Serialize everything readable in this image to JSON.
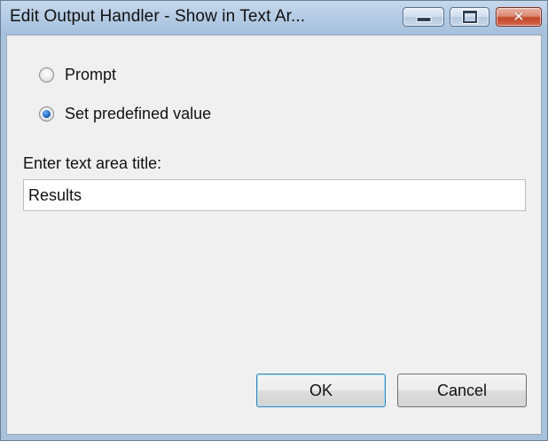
{
  "window": {
    "title": "Edit Output Handler - Show in Text Ar...",
    "minimize_icon": "minimize-icon",
    "maximize_icon": "maximize-icon",
    "close_icon": "close-icon",
    "close_glyph": "✕"
  },
  "options": {
    "prompt_label": "Prompt",
    "predefined_label": "Set predefined value",
    "selected": "predefined"
  },
  "field": {
    "label": "Enter text area title:",
    "value": "Results"
  },
  "buttons": {
    "ok_label": "OK",
    "cancel_label": "Cancel"
  }
}
